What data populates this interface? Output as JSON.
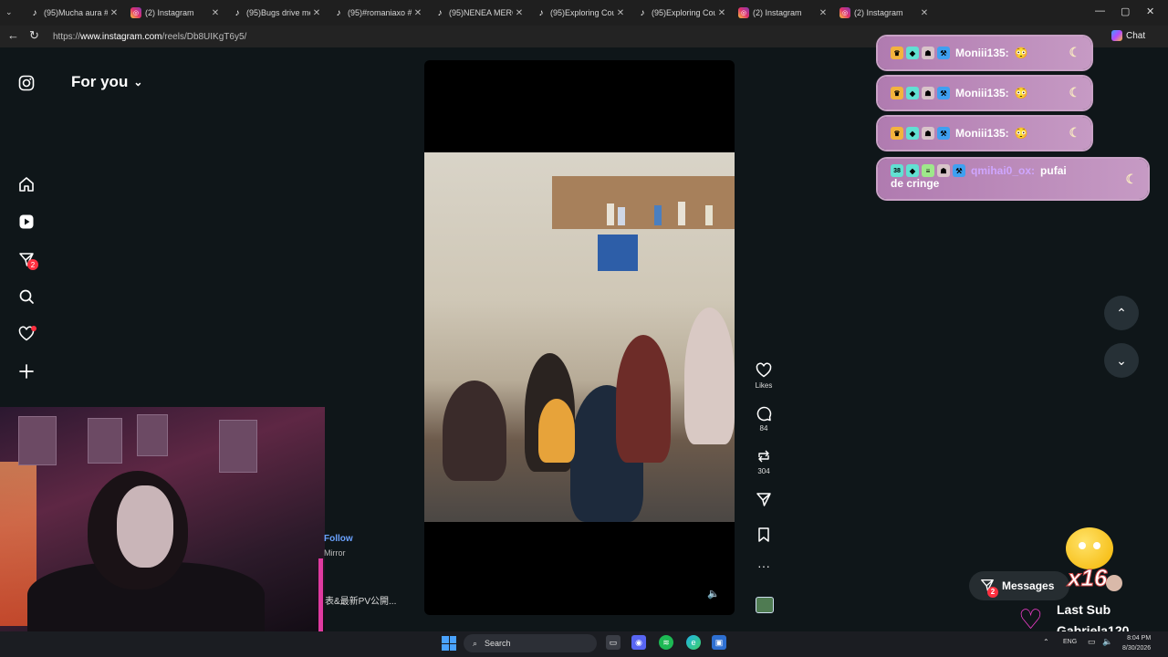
{
  "browser": {
    "tabs": [
      {
        "title": "(95)Mucha aura #cat",
        "favicon": "tiktok-icon"
      },
      {
        "title": "(2) Instagram",
        "favicon": "instagram-icon"
      },
      {
        "title": "(95)Bugs drive me cr",
        "favicon": "tiktok-icon"
      },
      {
        "title": "(95)#romaniaxo #br",
        "favicon": "tiktok-icon"
      },
      {
        "title": "(95)NENEA MERCAN",
        "favicon": "tiktok-icon"
      },
      {
        "title": "(95)Exploring Couple",
        "favicon": "tiktok-icon"
      },
      {
        "title": "(95)Exploring Couple",
        "favicon": "tiktok-icon"
      },
      {
        "title": "(2) Instagram",
        "favicon": "instagram-icon"
      },
      {
        "title": "(2) Instagram",
        "favicon": "instagram-icon"
      }
    ],
    "url_prefix": "https://",
    "url_domain": "www.instagram.com",
    "url_path": "/reels/Db8UIKgT6y5/",
    "chat_label": "Chat"
  },
  "instagram": {
    "feed_title": "For you",
    "notification_count": "2",
    "reel": {
      "likes_label": "Likes",
      "comments": "84",
      "reposts": "304"
    },
    "post": {
      "follow_label": "Follow",
      "audio_label": "Mirror",
      "caption": "表&最新PV公開..."
    },
    "messages_label": "Messages",
    "messages_count": "2"
  },
  "stream_chat": [
    {
      "user": "Moniii135:",
      "message": "😳"
    },
    {
      "user": "Moniii135:",
      "message": "😳"
    },
    {
      "user": "Moniii135:",
      "message": "😳"
    },
    {
      "user": "qmihai0_ox:",
      "message": "pufai",
      "message_line2": "de cringe",
      "level": "38"
    }
  ],
  "stream_overlay": {
    "multiplier": "x16",
    "last_sub_label": "Last Sub",
    "last_sub_name": "Gabriela120"
  },
  "taskbar": {
    "search_label": "Search",
    "language": "ENG",
    "time": "8:04 PM",
    "date": "8/30/2026"
  }
}
